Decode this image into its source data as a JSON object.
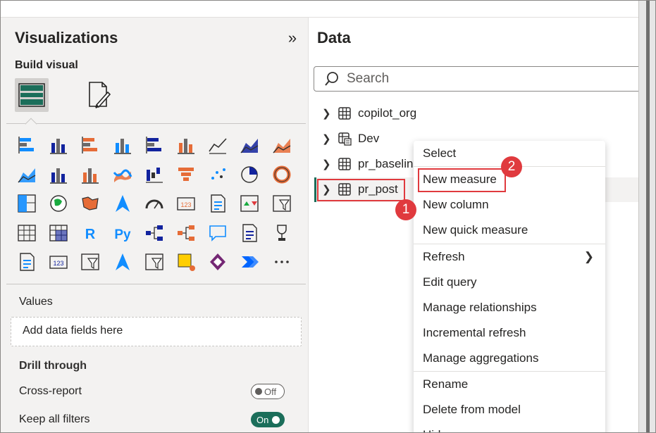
{
  "visualizations": {
    "title": "Visualizations",
    "collapse_glyph": "»",
    "build_visual_label": "Build visual",
    "icons": [
      [
        "stacked-bar-chart-icon",
        "stacked-column-chart-icon",
        "clustered-bar-chart-icon",
        "clustered-column-chart-icon",
        "100-stacked-bar-chart-icon",
        "100-stacked-column-chart-icon",
        "line-chart-icon",
        "area-chart-icon",
        "stacked-area-chart-icon"
      ],
      [
        "100-stacked-area-chart-icon",
        "line-and-stacked-column-icon",
        "line-and-clustered-column-icon",
        "ribbon-chart-icon",
        "waterfall-chart-icon",
        "funnel-chart-icon",
        "scatter-chart-icon",
        "pie-chart-icon",
        "donut-chart-icon"
      ],
      [
        "treemap-icon",
        "map-icon",
        "filled-map-icon",
        "azure-map-icon",
        "gauge-icon",
        "card-icon",
        "multi-row-card-icon",
        "kpi-icon",
        "slicer-icon"
      ],
      [
        "table-icon",
        "matrix-icon",
        "r-visual-icon",
        "python-visual-icon",
        "key-influencers-icon",
        "decomposition-tree-icon",
        "qa-icon",
        "smart-narrative-icon",
        "metrics-icon"
      ],
      [
        "paginated-report-icon",
        "card-new-icon",
        "slicer-new-icon",
        "azure-map-new-icon",
        "button-slicer-icon",
        "arcgis-map-icon",
        "power-apps-icon",
        "power-automate-icon",
        "more-visuals-icon"
      ]
    ],
    "values_label": "Values",
    "values_placeholder": "Add data fields here",
    "drill_through_label": "Drill through",
    "cross_report_label": "Cross-report",
    "cross_report_toggle": "Off",
    "keep_filters_label": "Keep all filters",
    "keep_filters_toggle": "On"
  },
  "data_pane": {
    "title": "Data",
    "search_placeholder": "Search",
    "tables": [
      {
        "name": "copilot_org",
        "icon": "table-icon"
      },
      {
        "name": "Dev",
        "icon": "calc-table-icon"
      },
      {
        "name": "pr_baselin",
        "icon": "table-icon"
      },
      {
        "name": "pr_post",
        "icon": "table-icon",
        "selected": true
      }
    ]
  },
  "context_menu": {
    "items": [
      "Select",
      "New measure",
      "New column",
      "New quick measure",
      "Refresh",
      "Edit query",
      "Manage relationships",
      "Incremental refresh",
      "Manage aggregations",
      "Rename",
      "Delete from model",
      "Hide"
    ],
    "submenu_on": "Refresh"
  },
  "annotations": {
    "badge1": "1",
    "badge2": "2",
    "accent_color": "#e03a3e",
    "toggle_on_color": "#1b6e5a"
  }
}
